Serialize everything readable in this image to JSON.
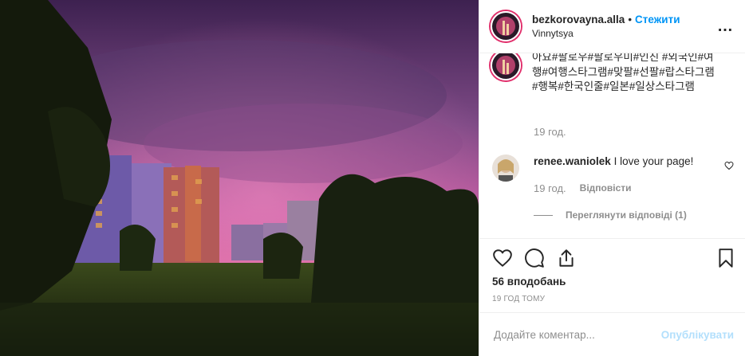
{
  "post": {
    "username": "bezkorovayna.alla",
    "separator": "•",
    "follow_label": "Стежити",
    "location": "Vinnytsya",
    "more_icon": "…"
  },
  "caption": {
    "text": "아요#팔로우#팔로우미#인친 #외국인#여행#여행스타그램#맞팔#선팔#랍스타그램#행복#한국인줄#일본#일상스타그램",
    "time": "19 год."
  },
  "comment": {
    "username": "renee.waniolek",
    "text": "I love your page!",
    "time": "19 год.",
    "reply_label": "Відповісти",
    "view_replies": "Переглянути відповіді (1)"
  },
  "likes": "56 вподобань",
  "time_ago": "19 ГОД ТОМУ",
  "add_comment": {
    "placeholder": "Додайте коментар...",
    "post_label": "Опублікувати"
  },
  "icons": [
    "heart-icon",
    "comment-icon",
    "share-icon",
    "bookmark-icon",
    "small-heart-icon",
    "more-icon"
  ],
  "colors": {
    "follow": "#0095f6",
    "post_disabled": "#b2dffc",
    "muted": "#8e8e8e",
    "sky_top": "#3a1e4a",
    "sky_mid": "#b05fa0"
  }
}
